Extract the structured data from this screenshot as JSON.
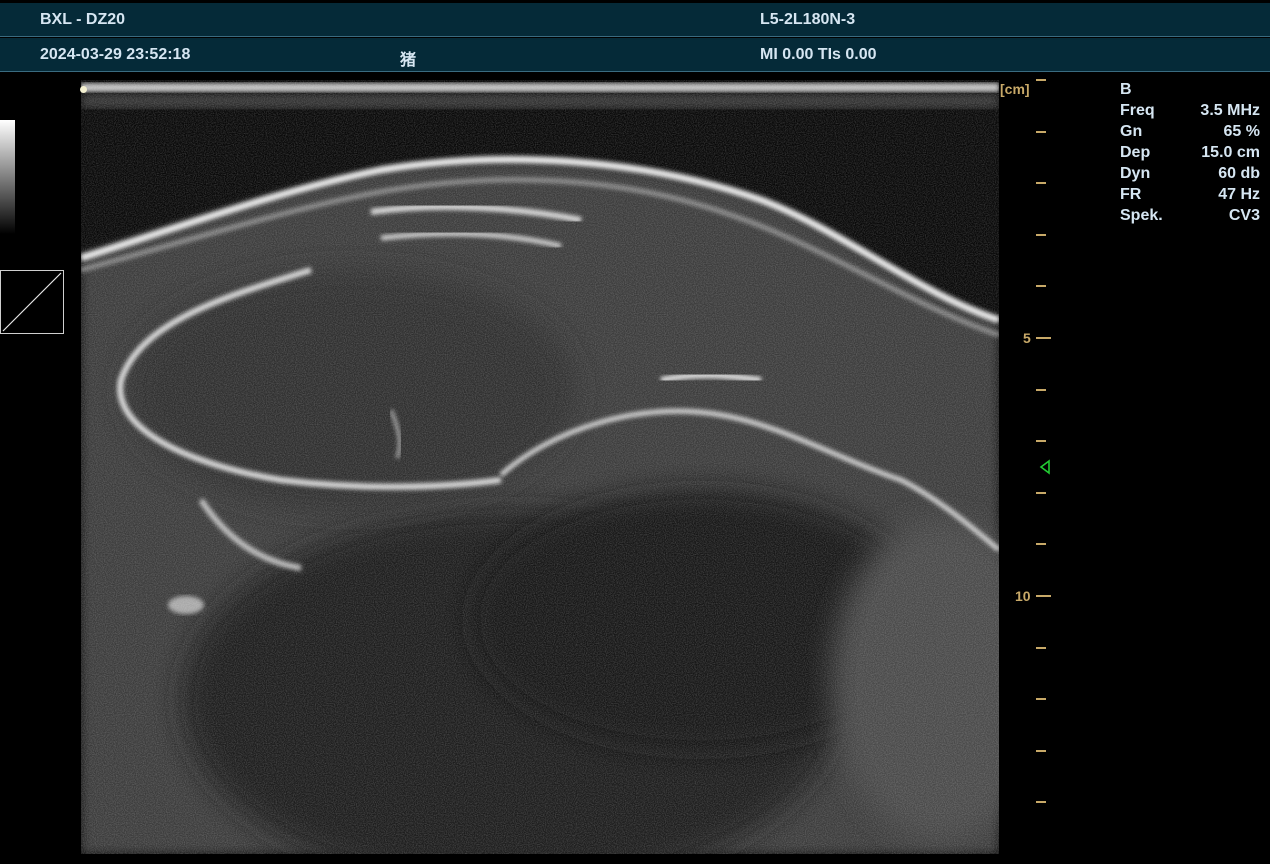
{
  "header": {
    "site_device": "BXL - DZ20",
    "probe": "L5-2L180N-3",
    "datetime": "2024-03-29 23:52:18",
    "patient_label": "猪",
    "safety_index": "MI 0.00 TIs 0.00"
  },
  "depth_scale": {
    "unit": "[cm]",
    "labels": [
      "5",
      "10"
    ]
  },
  "params": {
    "mode": "B",
    "rows": [
      {
        "label": "Freq",
        "value": "3.5 MHz"
      },
      {
        "label": "Gn",
        "value": "65 %"
      },
      {
        "label": "Dep",
        "value": "15.0 cm"
      },
      {
        "label": "Dyn",
        "value": "60 db"
      },
      {
        "label": "FR",
        "value": "47 Hz"
      },
      {
        "label": "Spek.",
        "value": "CV3"
      }
    ]
  },
  "icons": {
    "focus": "focus-marker-icon"
  },
  "colors": {
    "header_bg": "#052a38",
    "scale": "#c8a968",
    "focus_marker": "#22cc33"
  }
}
